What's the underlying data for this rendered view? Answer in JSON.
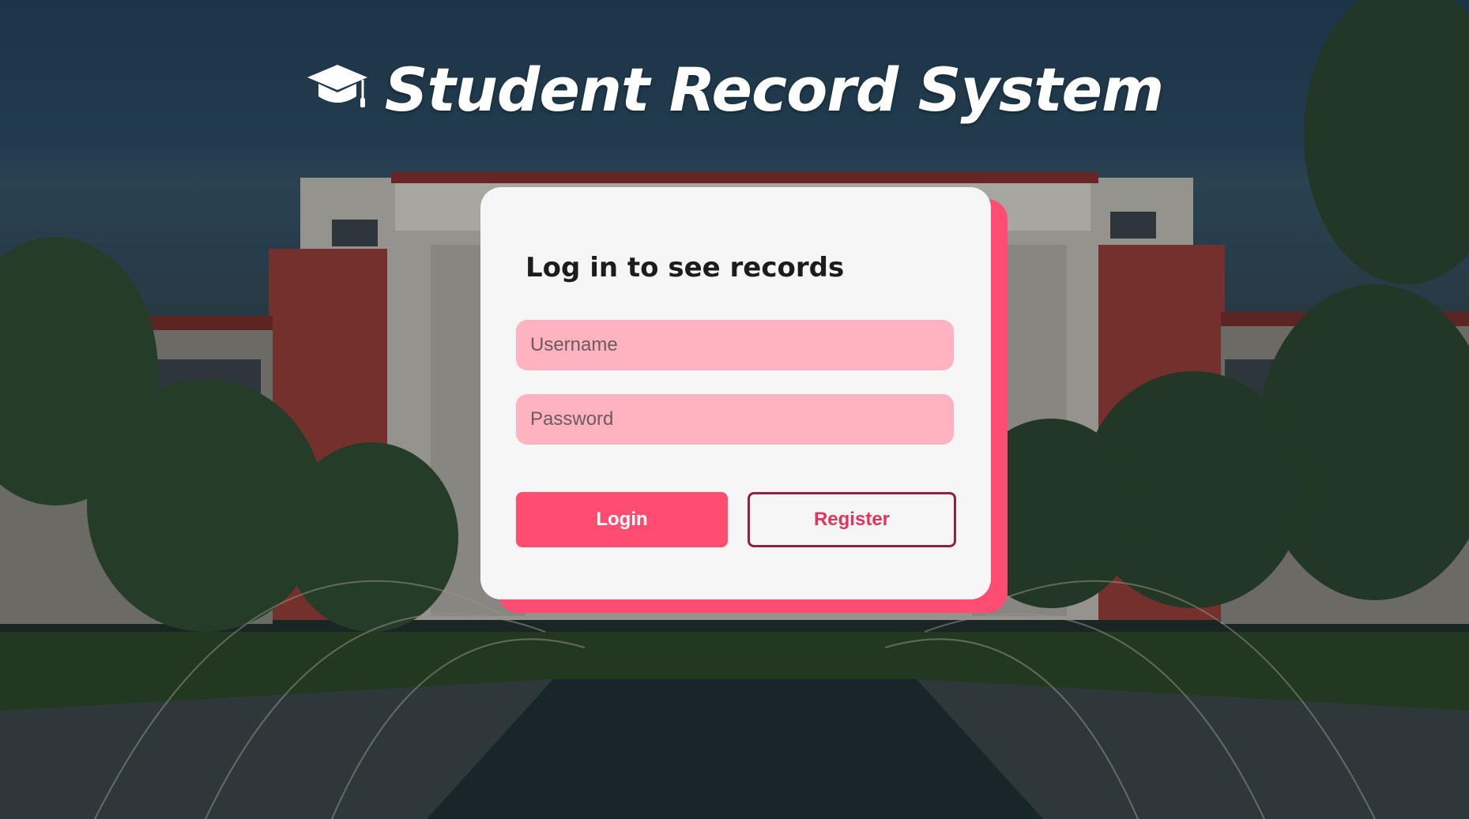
{
  "header": {
    "title": "Student Record System",
    "icon": "graduation-cap-icon"
  },
  "login_card": {
    "heading": "Log in to see records",
    "username_placeholder": "Username",
    "password_placeholder": "Password",
    "login_label": "Login",
    "register_label": "Register"
  },
  "colors": {
    "accent": "#ff4d72",
    "input_bg": "#ffb3c1",
    "card_bg": "#f7f6f7",
    "register_border": "#8e2440",
    "register_text": "#e0355e"
  }
}
